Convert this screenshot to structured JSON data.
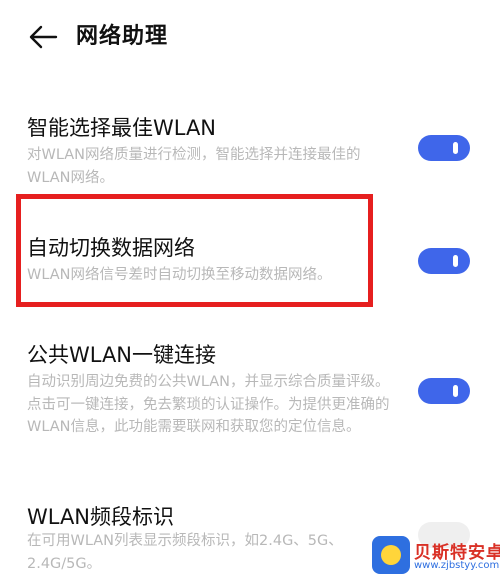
{
  "header": {
    "title": "网络助理",
    "back_icon": "back-arrow-icon"
  },
  "items": [
    {
      "title": "智能选择最佳WLAN",
      "description": "对WLAN网络质量进行检测，智能选择并连接最佳的WLAN网络。",
      "toggle_on": true
    },
    {
      "title": "自动切换数据网络",
      "description": "WLAN网络信号差时自动切换至移动数据网络。",
      "toggle_on": true
    },
    {
      "title": "公共WLAN一键连接",
      "description": "自动识别周边免费的公共WLAN，并显示综合质量评级。点击可一键连接，免去繁琐的认证操作。为提供更准确的WLAN信息，此功能需要联网和获取您的定位信息。",
      "toggle_on": true
    },
    {
      "title": "WLAN频段标识",
      "description": "在可用WLAN列表显示频段标识，如2.4G、5G、2.4G/5G。",
      "toggle_on": false
    }
  ],
  "colors": {
    "accent": "#3f66ea",
    "highlight": "#e61f1f",
    "desc_text": "#b8b8b8"
  },
  "watermark": {
    "text": "贝斯特安卓网",
    "url": "www.zjbstyy.com"
  }
}
